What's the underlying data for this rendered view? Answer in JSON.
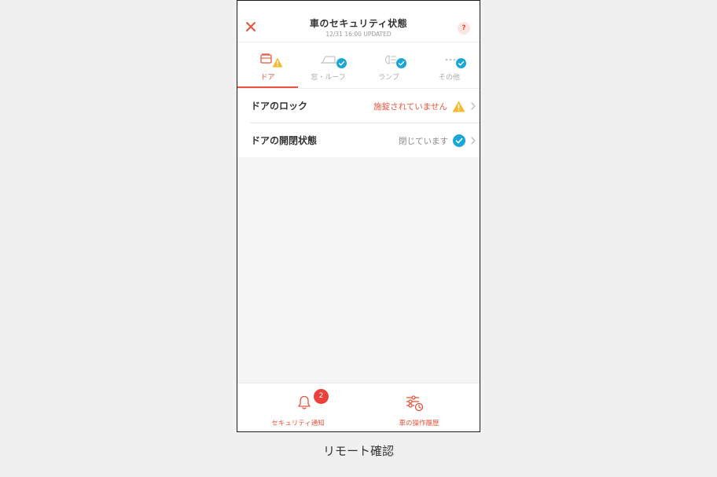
{
  "header": {
    "title": "車のセキュリティ状態",
    "subtitle": "12/31 16:00 UPDATED",
    "close_icon": "close-icon",
    "help_label": "?"
  },
  "tabs": [
    {
      "label": "ドア",
      "icon": "door-icon",
      "status": "warning",
      "active": true
    },
    {
      "label": "窓・ルーフ",
      "icon": "window-icon",
      "status": "ok",
      "active": false
    },
    {
      "label": "ランプ",
      "icon": "lamp-icon",
      "status": "ok",
      "active": false
    },
    {
      "label": "その他",
      "icon": "more-icon",
      "status": "ok",
      "active": false
    }
  ],
  "rows": [
    {
      "label": "ドアのロック",
      "status": "施錠されていません",
      "state": "warning"
    },
    {
      "label": "ドアの開閉状態",
      "status": "閉じています",
      "state": "ok"
    }
  ],
  "bottom_nav": [
    {
      "label": "セキュリティ通知",
      "icon": "bell-icon",
      "badge": "2"
    },
    {
      "label": "車の操作履歴",
      "icon": "history-icon"
    }
  ],
  "caption": "リモート確認",
  "colors": {
    "accent": "#e8543b",
    "warning": "#f5b82e",
    "ok": "#1aa6d6",
    "badge": "#e8423a"
  }
}
